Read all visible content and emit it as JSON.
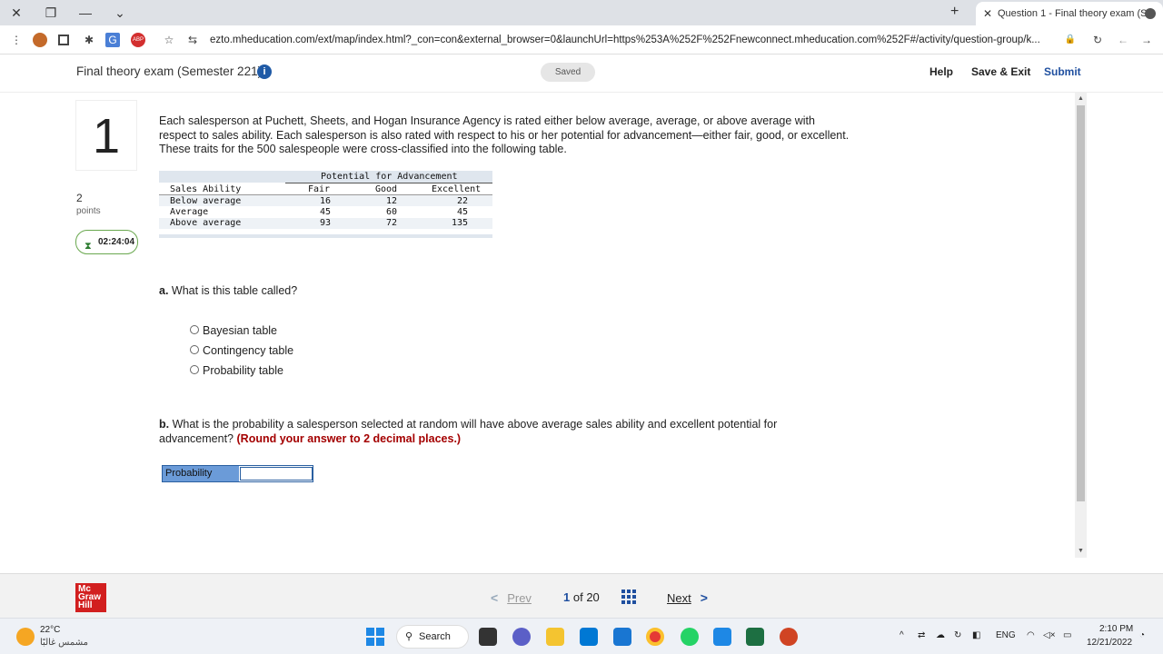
{
  "browser": {
    "tab_title": "Question 1 - Final theory exam (S",
    "url": "ezto.mheducation.com/ext/map/index.html?_con=con&external_browser=0&launchUrl=https%253A%252F%252Fnewconnect.mheducation.com%252F#/activity/question-group/k..."
  },
  "header": {
    "exam_title": "Final theory exam (Semester 221)",
    "saved_label": "Saved",
    "help_label": "Help",
    "save_exit_label": "Save & Exit",
    "submit_label": "Submit"
  },
  "question": {
    "number": "1",
    "points_value": "2",
    "points_label": "points",
    "timer": "02:24:04",
    "text": "Each salesperson at Puchett, Sheets, and Hogan Insurance Agency is rated either below average, average, or above average with respect to sales ability. Each salesperson is also rated with respect to his or her potential for advancement—either fair, good, or excellent. These traits for the 500 salespeople were cross-classified into the following table.",
    "table": {
      "group_header": "Potential for Advancement",
      "row_header": "Sales Ability",
      "columns": [
        "Fair",
        "Good",
        "Excellent"
      ],
      "rows": [
        {
          "label": "Below average",
          "values": [
            "16",
            "12",
            "22"
          ]
        },
        {
          "label": "Average",
          "values": [
            "45",
            "60",
            "45"
          ]
        },
        {
          "label": "Above average",
          "values": [
            "93",
            "72",
            "135"
          ]
        }
      ]
    },
    "part_a": {
      "letter": "a.",
      "prompt": "What is this table called?",
      "options": [
        "Bayesian table",
        "Contingency table",
        "Probability table"
      ]
    },
    "part_b": {
      "letter": "b.",
      "prompt": "What is the probability a salesperson selected at random will have above average sales ability and excellent potential for advancement?",
      "emphasis": "(Round your answer to 2 decimal places.)",
      "answer_label": "Probability",
      "answer_value": ""
    }
  },
  "footer": {
    "logo_lines": [
      "Mc",
      "Graw",
      "Hill"
    ],
    "prev_label": "Prev",
    "next_label": "Next",
    "current_page": "1",
    "of_label": "of",
    "total_pages": "20"
  },
  "taskbar": {
    "temperature": "22°C",
    "weather_desc": "مشمس غالبًا",
    "search_label": "Search",
    "lang": "ENG",
    "time": "2:10 PM",
    "date": "12/21/2022"
  },
  "colors": {
    "accent": "#1f4f9f",
    "emphasis_red": "#a40000",
    "timer_border": "#6aa84f",
    "logo_red": "#d21f1f"
  }
}
